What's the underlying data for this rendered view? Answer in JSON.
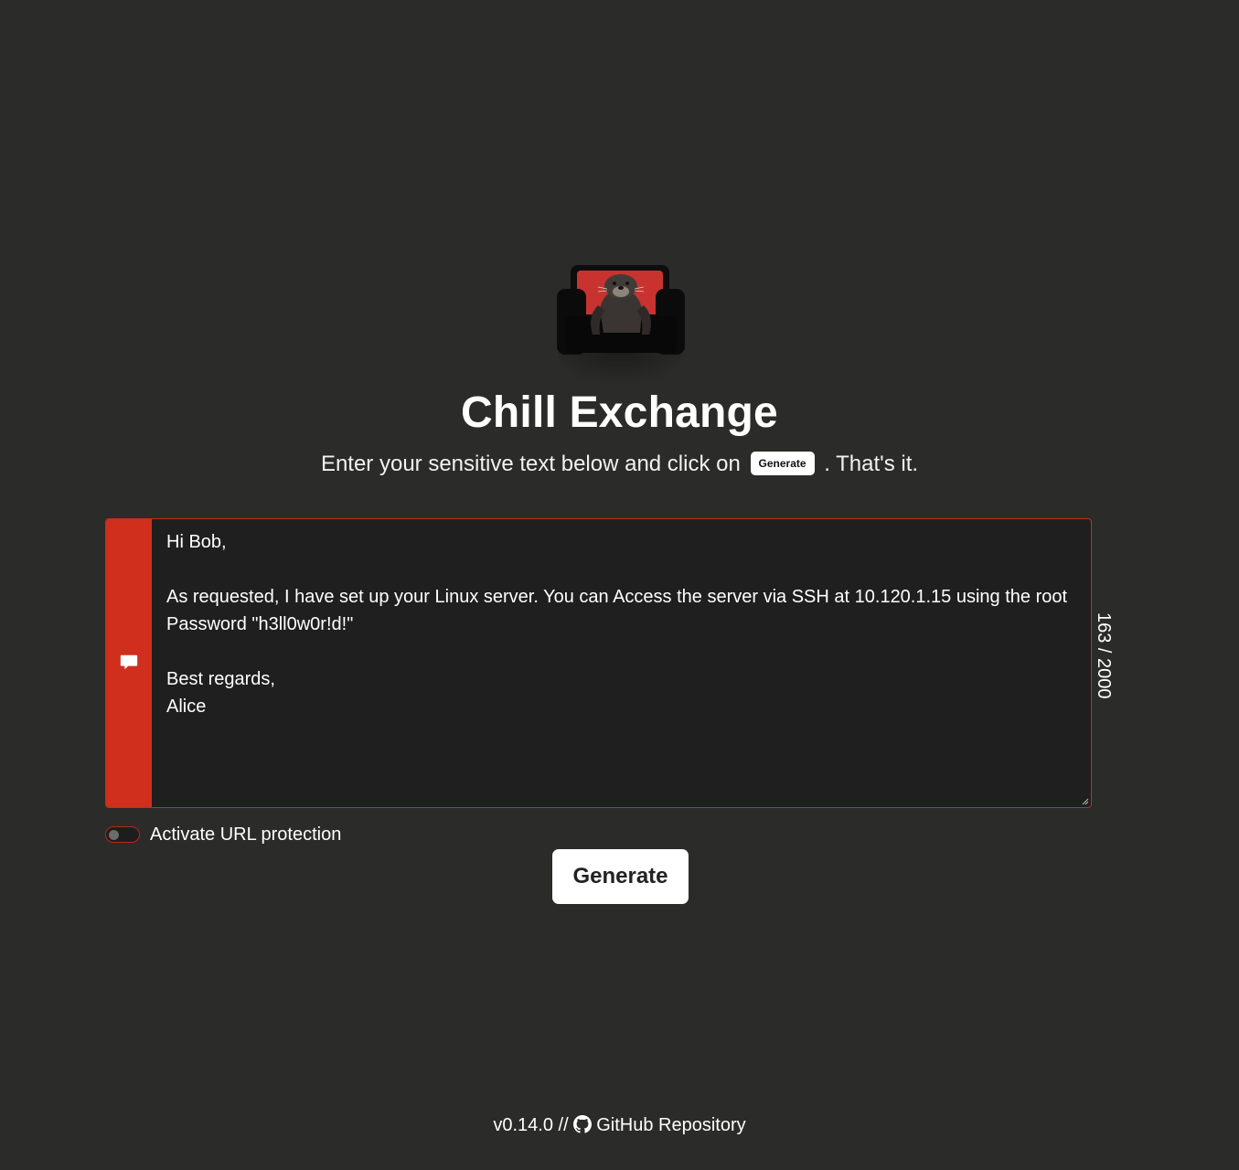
{
  "app": {
    "title": "Chill Exchange",
    "subtitle_before": "Enter your sensitive text below and click on",
    "subtitle_button": "Generate",
    "subtitle_after": ". That's it."
  },
  "message": {
    "icon": "chat-bubble-icon",
    "value": "Hi Bob,\n\nAs requested, I have set up your Linux server. You can Access the server via SSH at 10.120.1.15 using the root Password \"h3ll0w0r!d!\"\n\nBest regards,\nAlice",
    "counter": "163 / 2000"
  },
  "options": {
    "url_protection_label": "Activate URL protection",
    "url_protection_enabled": false
  },
  "actions": {
    "generate_label": "Generate"
  },
  "footer": {
    "version": "v0.14.0 //",
    "repo_icon": "github-icon",
    "repo_label": "GitHub Repository"
  },
  "colors": {
    "background": "#2b2b2a",
    "accent": "#cf2f1c",
    "textarea_bg": "#201f20",
    "button_bg": "#ffffff"
  }
}
